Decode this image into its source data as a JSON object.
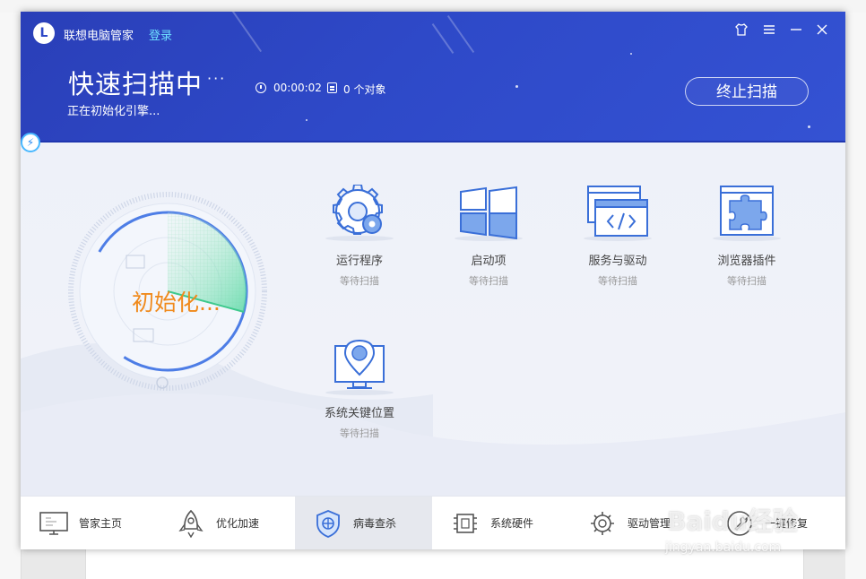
{
  "app": {
    "title": "联想电脑管家",
    "login_label": "登录"
  },
  "window_controls": [
    "skin-icon",
    "menu-icon",
    "minimize-icon",
    "close-icon"
  ],
  "scan": {
    "title": "快速扫描中",
    "dots": "···",
    "subtitle": "正在初始化引擎...",
    "elapsed": "00:00:02",
    "objects": "0 个对象",
    "stop_label": "终止扫描",
    "gauge_label": "初始化..."
  },
  "scan_items": [
    {
      "name": "运行程序",
      "status": "等待扫描",
      "icon": "gear-icon"
    },
    {
      "name": "启动项",
      "status": "等待扫描",
      "icon": "windows-icon"
    },
    {
      "name": "服务与驱动",
      "status": "等待扫描",
      "icon": "code-window-icon"
    },
    {
      "name": "浏览器插件",
      "status": "等待扫描",
      "icon": "puzzle-icon"
    },
    {
      "name": "系统关键位置",
      "status": "等待扫描",
      "icon": "location-pin-icon"
    }
  ],
  "bottom_nav": [
    {
      "label": "管家主页",
      "icon": "monitor-icon",
      "active": false
    },
    {
      "label": "优化加速",
      "icon": "rocket-icon",
      "active": false
    },
    {
      "label": "病毒查杀",
      "icon": "shield-icon",
      "active": true
    },
    {
      "label": "系统硬件",
      "icon": "chip-icon",
      "active": false
    },
    {
      "label": "驱动管理",
      "icon": "gear-icon",
      "active": false
    },
    {
      "label": "一键修复",
      "icon": "wrench-icon",
      "active": false
    }
  ],
  "colors": {
    "header": "#2e49c8",
    "accent": "#3a8ee6",
    "gauge_text": "#f08a1c",
    "login": "#6ee0ff"
  },
  "watermark": {
    "brand": "Baidu经验",
    "url": "jingyan.baidu.com"
  }
}
